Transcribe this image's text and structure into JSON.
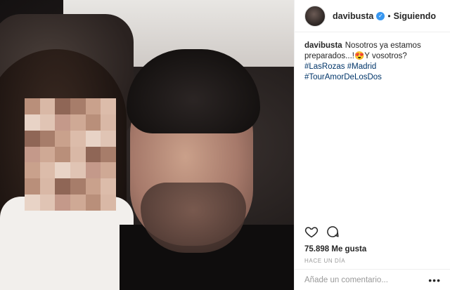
{
  "post": {
    "username": "davibusta",
    "follow_status": "Siguiendo",
    "separator": "•",
    "caption": {
      "username": "davibusta",
      "text_1": "Nosotros ya estamos preparados...!",
      "emoji": "😍",
      "text_2": "Y vosotros?",
      "tags": [
        "#LasRozas",
        "#Madrid",
        "#TourAmorDeLosDos"
      ]
    },
    "likes": "75.898 Me gusta",
    "timestamp": "HACE UN DÍA",
    "comment_placeholder": "Añade un comentario...",
    "more_label": "•••"
  },
  "icons": {
    "like": "heart-icon",
    "comment": "comment-icon",
    "verified": "verified-badge-icon",
    "more": "more-options-icon"
  },
  "colors": {
    "hashtag": "#003569",
    "verified": "#3897f0",
    "muted": "#999999",
    "text": "#262626"
  }
}
